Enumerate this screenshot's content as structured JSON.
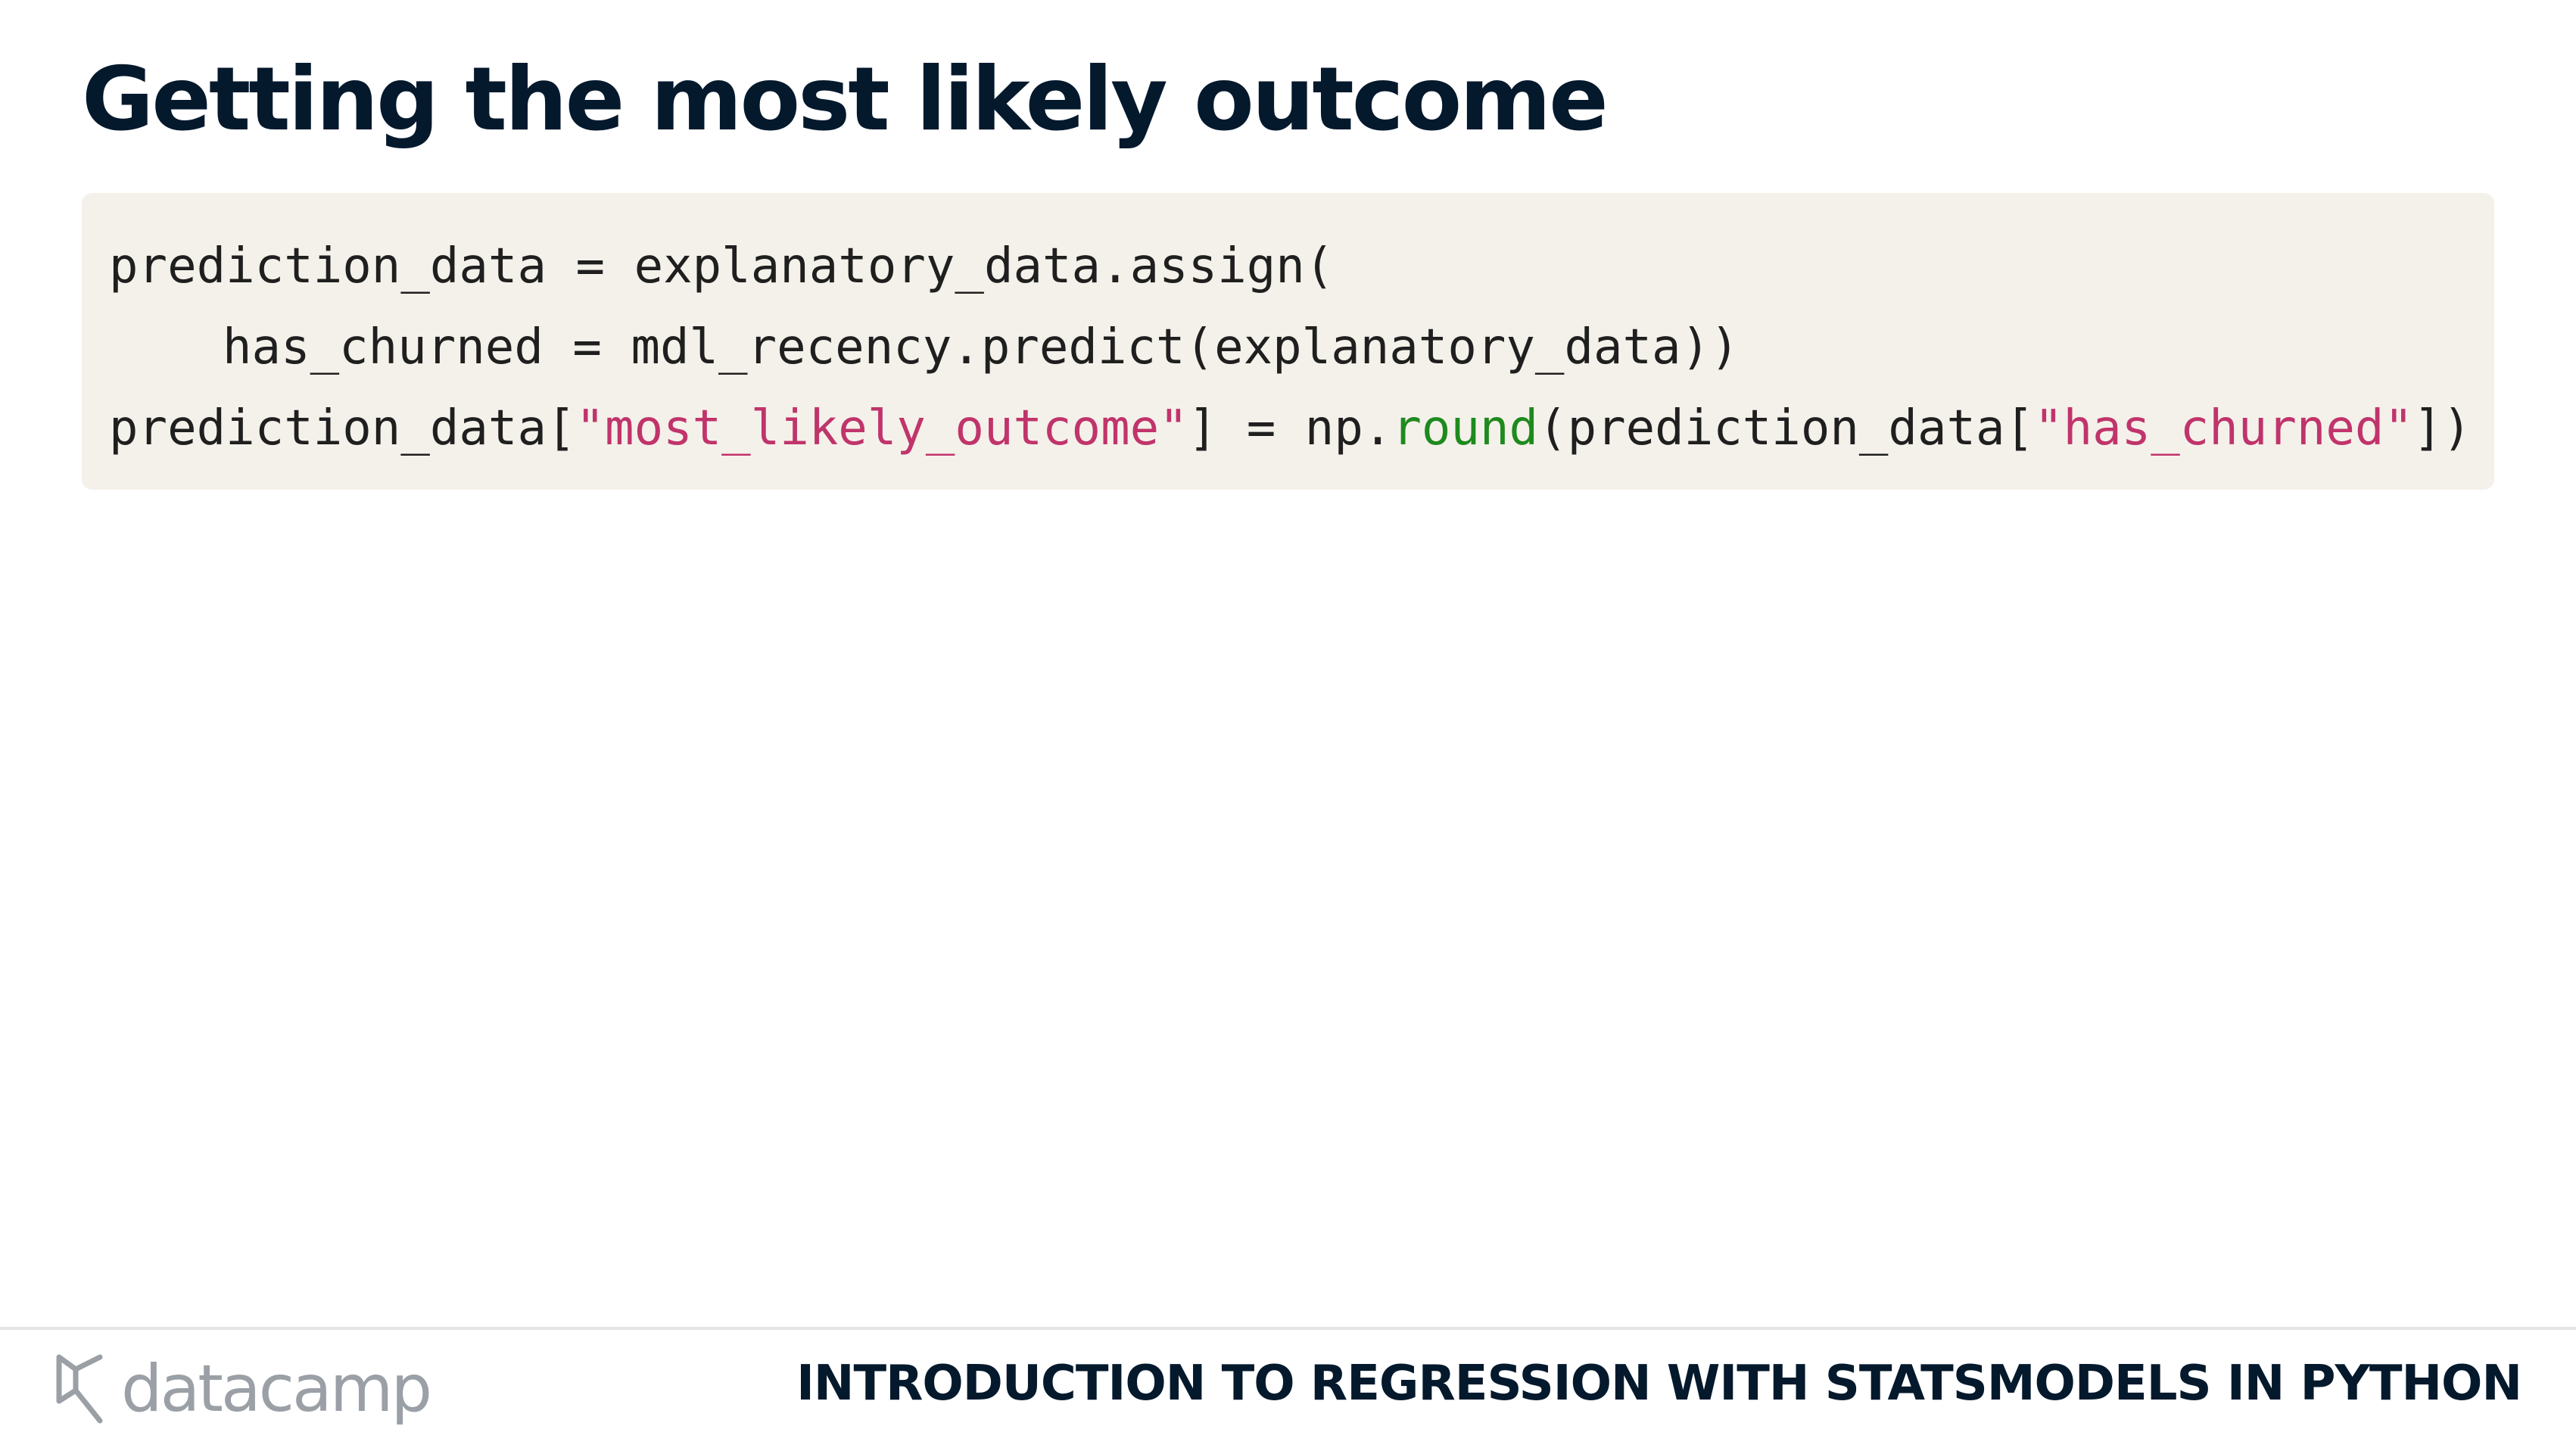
{
  "slide": {
    "title": "Getting the most likely outcome"
  },
  "code": {
    "line1": "prediction_data = explanatory_data.assign(",
    "line2": "has_churned = mdl_recency.predict(explanatory_data))",
    "line3": {
      "part1": "prediction_data[",
      "string1": "\"most_likely_outcome\"",
      "part2": "] = np.",
      "func": "round",
      "part3": "(prediction_data[",
      "string2": "\"has_churned\"",
      "part4": "])"
    }
  },
  "footer": {
    "brand": "datacamp",
    "course_title": "INTRODUCTION TO REGRESSION WITH STATSMODELS IN PYTHON"
  },
  "icons": {
    "logo": "datacamp-logo-icon"
  },
  "colors": {
    "title": "#05192d",
    "code_background": "#f4f1ea",
    "string": "#c0346b",
    "function": "#1e8a1e",
    "logo_gray": "#9aa0a6"
  }
}
